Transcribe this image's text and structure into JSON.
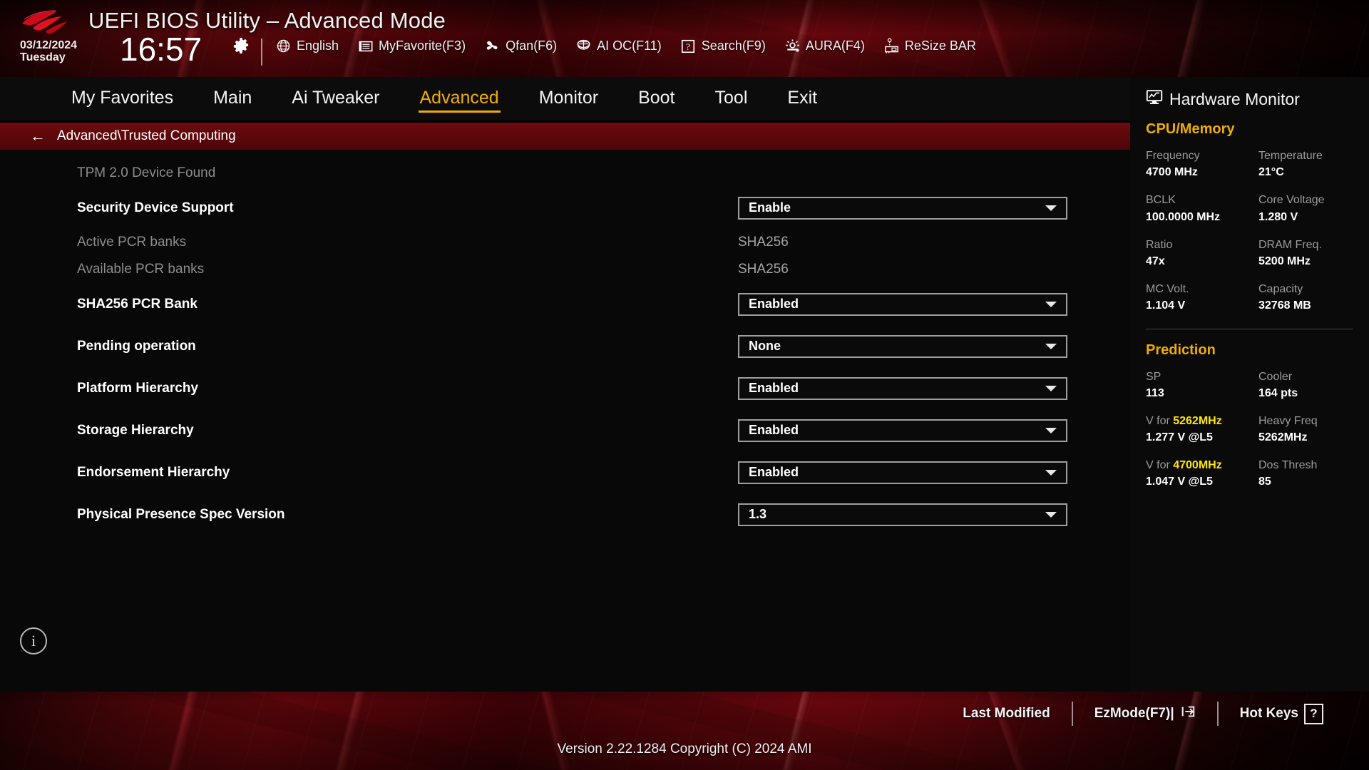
{
  "header": {
    "logo": "asus-rog-logo",
    "title": "UEFI BIOS Utility – Advanced Mode",
    "date": "03/12/2024",
    "weekday": "Tuesday",
    "time": "16:57",
    "gear_icon": "gear-icon",
    "tools": [
      {
        "icon": "globe-icon",
        "label": "English"
      },
      {
        "icon": "myfavorite-icon",
        "label": "MyFavorite(F3)"
      },
      {
        "icon": "qfan-icon",
        "label": "Qfan(F6)"
      },
      {
        "icon": "aioc-icon",
        "label": "AI OC(F11)"
      },
      {
        "icon": "search-icon",
        "label": "Search(F9)"
      },
      {
        "icon": "aura-icon",
        "label": "AURA(F4)"
      },
      {
        "icon": "resizebar-icon",
        "label": "ReSize BAR"
      }
    ]
  },
  "nav": {
    "tabs": [
      {
        "label": "My Favorites",
        "active": false
      },
      {
        "label": "Main",
        "active": false
      },
      {
        "label": "Ai Tweaker",
        "active": false
      },
      {
        "label": "Advanced",
        "active": true
      },
      {
        "label": "Monitor",
        "active": false
      },
      {
        "label": "Boot",
        "active": false
      },
      {
        "label": "Tool",
        "active": false
      },
      {
        "label": "Exit",
        "active": false
      }
    ],
    "active_color": "#f0ad00"
  },
  "breadcrumb": {
    "back_icon": "back-arrow-icon",
    "path": "Advanced\\Trusted Computing"
  },
  "main": {
    "info_icon": "info-icon",
    "rows": [
      {
        "type": "info",
        "label": "TPM 2.0 Device Found",
        "value": ""
      },
      {
        "type": "control",
        "label": "Security Device Support",
        "value": "Enable"
      },
      {
        "type": "info",
        "label": "Active PCR banks",
        "value": "SHA256"
      },
      {
        "type": "info",
        "label": "Available PCR banks",
        "value": "SHA256"
      },
      {
        "type": "control",
        "label": "SHA256 PCR Bank",
        "value": "Enabled"
      },
      {
        "type": "control",
        "label": "Pending operation",
        "value": "None"
      },
      {
        "type": "control",
        "label": "Platform Hierarchy",
        "value": "Enabled"
      },
      {
        "type": "control",
        "label": "Storage Hierarchy",
        "value": "Enabled"
      },
      {
        "type": "control",
        "label": "Endorsement Hierarchy",
        "value": "Enabled"
      },
      {
        "type": "control",
        "label": "Physical Presence Spec Version",
        "value": "1.3"
      }
    ]
  },
  "hardware_monitor": {
    "icon": "monitor-icon",
    "title": "Hardware Monitor",
    "sections": [
      {
        "name": "CPU/Memory",
        "color": "#f0ad00",
        "cells": [
          {
            "key": "Frequency",
            "value": "4700 MHz"
          },
          {
            "key": "Temperature",
            "value": "21°C"
          },
          {
            "key": "BCLK",
            "value": "100.0000 MHz"
          },
          {
            "key": "Core Voltage",
            "value": "1.280 V"
          },
          {
            "key": "Ratio",
            "value": "47x"
          },
          {
            "key": "DRAM Freq.",
            "value": "5200 MHz"
          },
          {
            "key": "MC Volt.",
            "value": "1.104 V"
          },
          {
            "key": "Capacity",
            "value": "32768 MB"
          }
        ]
      },
      {
        "name": "Prediction",
        "color": "#f0ad00",
        "cells": [
          {
            "key": "SP",
            "value": "113"
          },
          {
            "key": "Cooler",
            "value": "164 pts"
          },
          {
            "key": "V for ",
            "key_highlight": "5262MHz",
            "value": "1.277 V @L5"
          },
          {
            "key": "Heavy Freq",
            "value": "5262MHz"
          },
          {
            "key": "V for ",
            "key_highlight": "4700MHz",
            "value": "1.047 V @L5"
          },
          {
            "key": "Dos Thresh",
            "value": "85"
          }
        ]
      }
    ],
    "highlight_color": "#ffe800"
  },
  "footer": {
    "version": "Version 2.22.1284 Copyright (C) 2024 AMI",
    "buttons": [
      {
        "label": "Last Modified",
        "icon": ""
      },
      {
        "label": "EzMode(F7)|",
        "icon": "exit-arrow-icon"
      },
      {
        "label": "Hot Keys",
        "icon": "question-box-icon"
      }
    ]
  }
}
